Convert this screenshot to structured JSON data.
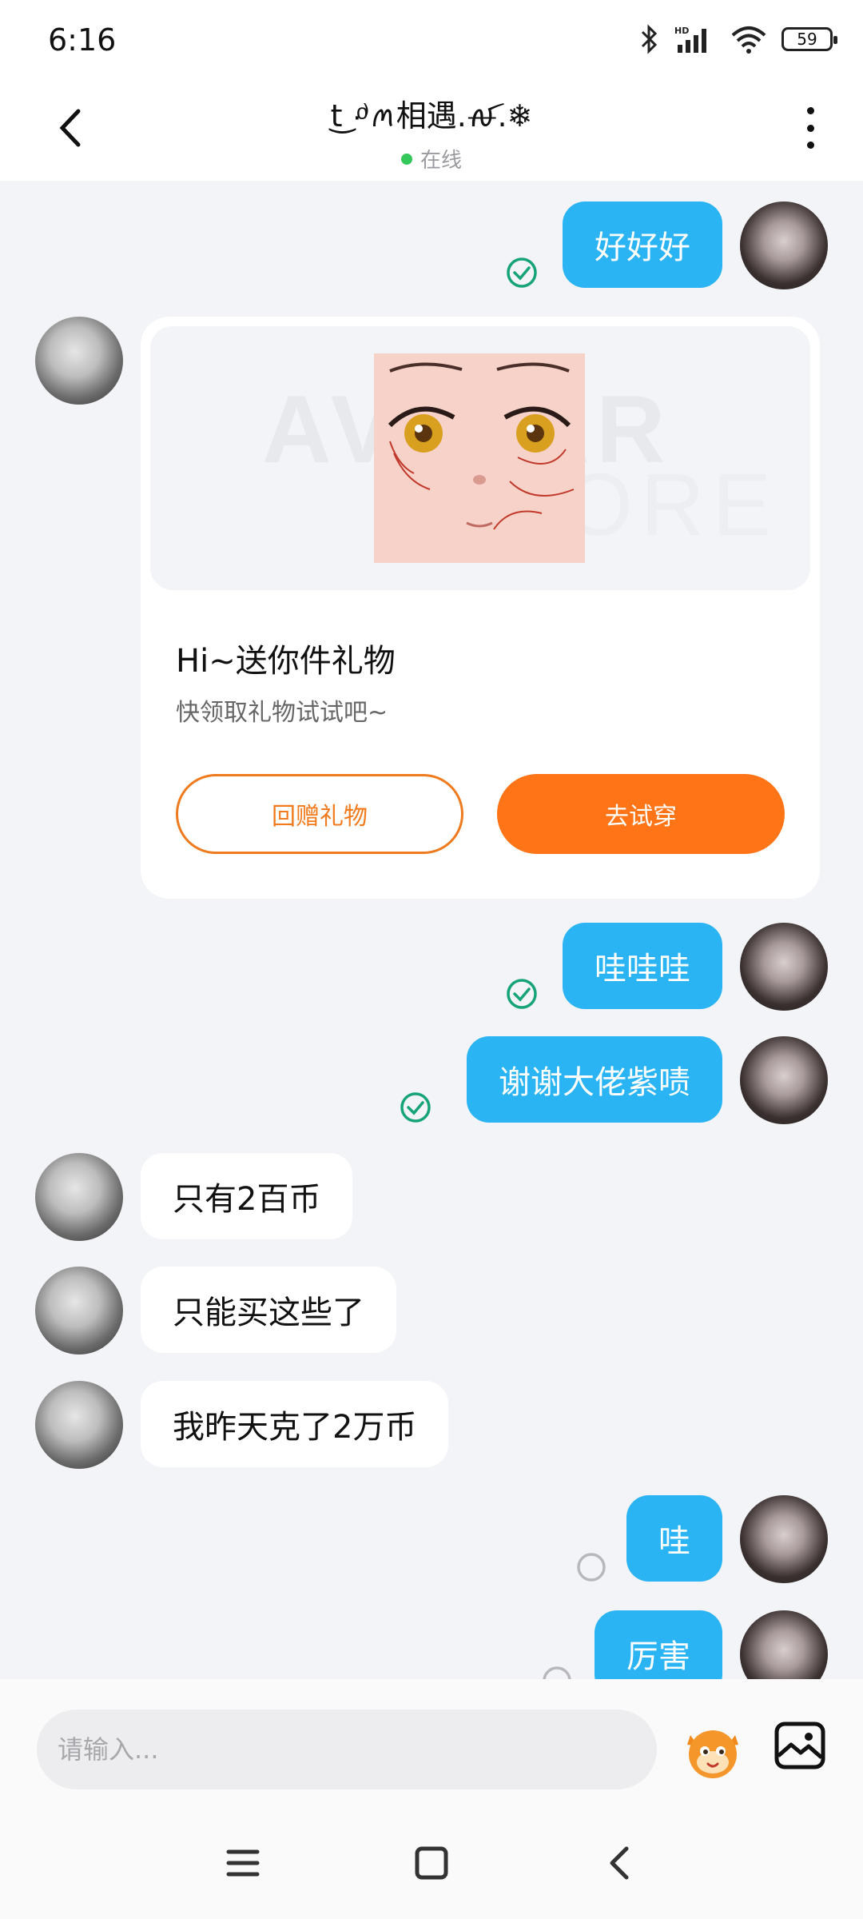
{
  "status_bar": {
    "time": "6:16",
    "battery": "59"
  },
  "header": {
    "title": " t͜ ·ͦ⁾ꪔ相遇.ꫛ.❄",
    "status": "在线"
  },
  "messages": [
    {
      "side": "right",
      "text": "好好好",
      "status": "read"
    },
    {
      "side": "left",
      "type": "gift"
    },
    {
      "side": "right",
      "text": "哇哇哇",
      "status": "read"
    },
    {
      "side": "right",
      "text": "谢谢大佬紫啧",
      "status": "read"
    },
    {
      "side": "left",
      "text": "只有2百币"
    },
    {
      "side": "left",
      "text": "只能买这些了"
    },
    {
      "side": "left",
      "text": "我昨天克了2万币"
    },
    {
      "side": "right",
      "text": "哇",
      "status": "sent"
    },
    {
      "side": "right",
      "text": "厉害",
      "status": "sent"
    }
  ],
  "gift_card": {
    "title": "Hi~送你件礼物",
    "subtitle": "快领取礼物试试吧~",
    "return_label": "回赠礼物",
    "try_label": "去试穿"
  },
  "input": {
    "placeholder": "请输入..."
  },
  "colors": {
    "bubble_me": "#2ab4f3",
    "accent_orange": "#ff7416",
    "read_check": "#16a37a",
    "online": "#34c759"
  }
}
